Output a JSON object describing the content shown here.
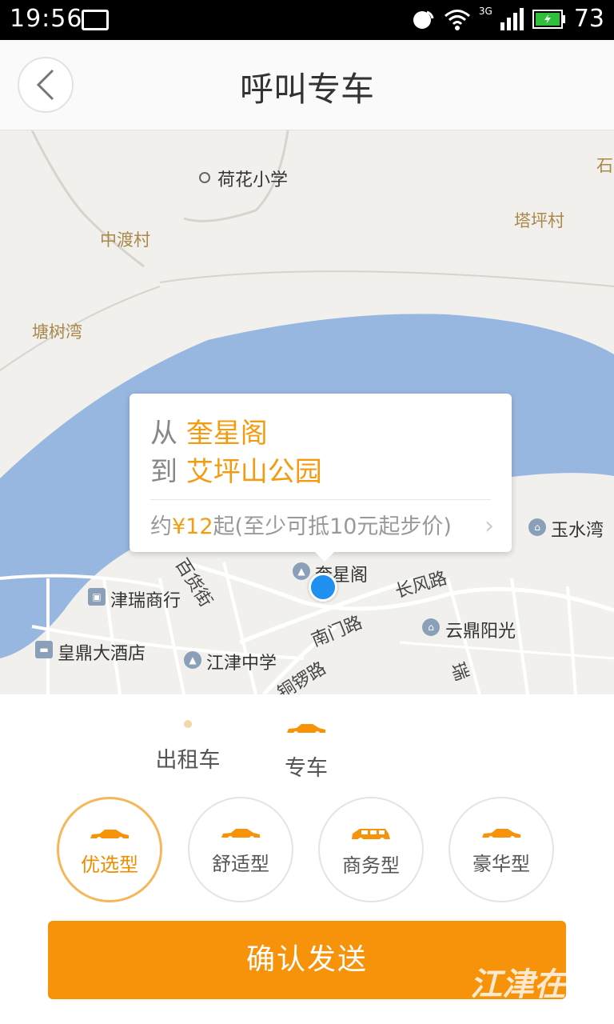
{
  "status_bar": {
    "time": "19:56",
    "network": "3G",
    "battery": "73"
  },
  "header": {
    "title": "呼叫专车"
  },
  "map": {
    "labels": {
      "hehua_school": "荷花小学",
      "zhongdu_village": "中渡村",
      "taping_village": "塔坪村",
      "tangshu_bay": "塘树湾",
      "shi": "石",
      "baihuo_street": "百货街",
      "jinrui_mall": "津瑞商行",
      "kuixingge": "奎星阁",
      "changfeng_road": "长风路",
      "nanmen_road": "南门路",
      "yunding_sunshine": "云鼎阳光",
      "huangding_hotel": "皇鼎大酒店",
      "jiangjin_middle_school": "江津中学",
      "tongluo_road": "铜锣路",
      "rui": "瑞",
      "yushui_bay": "玉水湾"
    }
  },
  "callout": {
    "from_prefix": "从",
    "from_place": "奎星阁",
    "to_prefix": "到",
    "to_place": "艾坪山公园",
    "price_prefix": "约",
    "price_value": "¥12",
    "price_suffix": "起(至少可抵10元起步价)"
  },
  "service_modes": [
    {
      "label": "出租车",
      "selected": false
    },
    {
      "label": "专车",
      "selected": true
    }
  ],
  "car_types": [
    {
      "label": "优选型",
      "selected": true,
      "icon": "sedan-icon"
    },
    {
      "label": "舒适型",
      "selected": false,
      "icon": "sedan-icon"
    },
    {
      "label": "商务型",
      "selected": false,
      "icon": "mpv-icon"
    },
    {
      "label": "豪华型",
      "selected": false,
      "icon": "sedan-icon"
    }
  ],
  "confirm_label": "确认发送",
  "watermark": "江津在",
  "colors": {
    "accent": "#f7930a",
    "river": "#98b7e0",
    "location": "#1f8ff0"
  }
}
